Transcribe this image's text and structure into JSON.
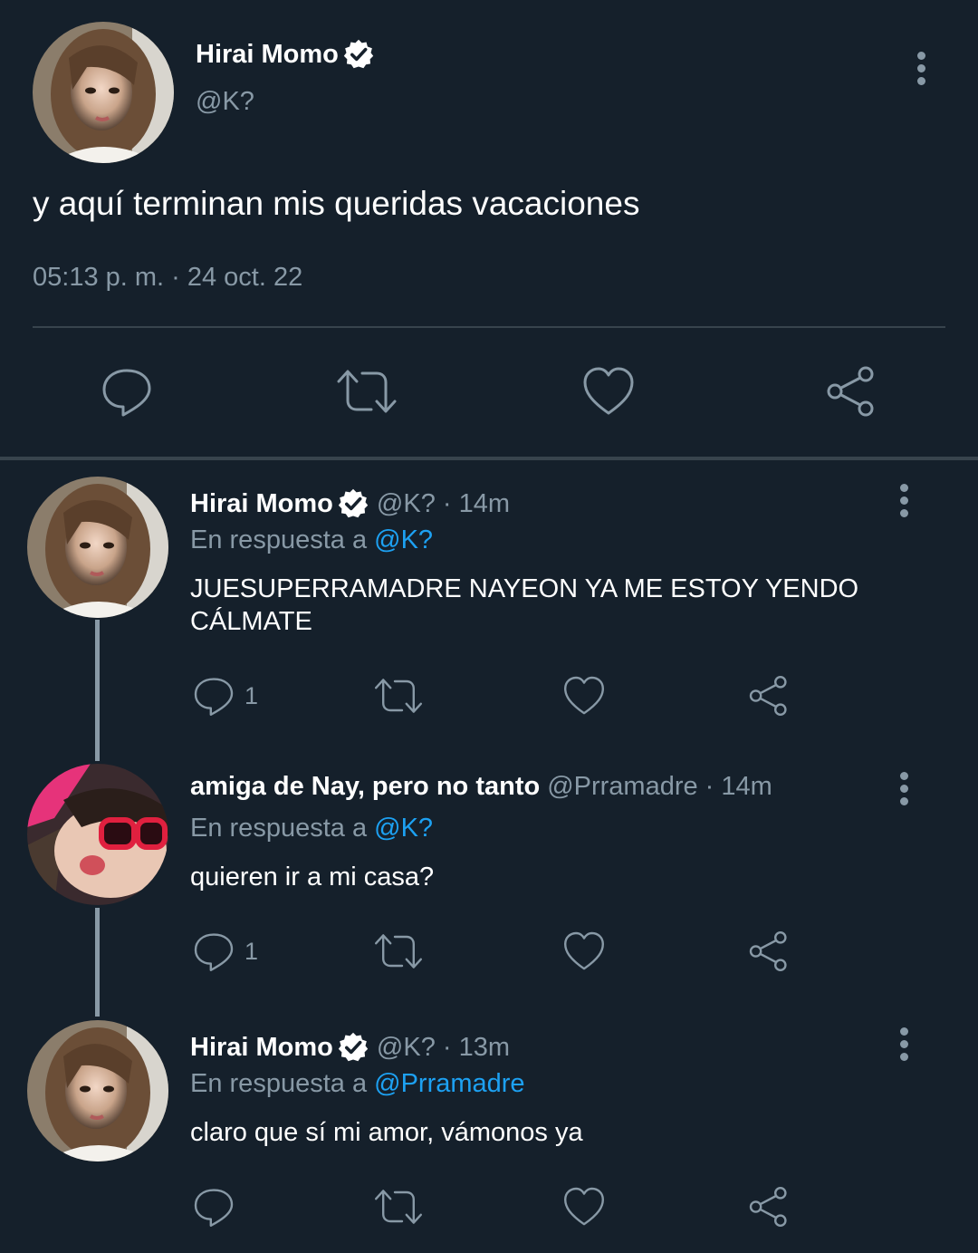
{
  "main_tweet": {
    "name": "Hirai Momo",
    "handle": "@K?",
    "text": "y aquí terminan mis queridas vacaciones",
    "timestamp": "05:13 p. m. · 24 oct. 22",
    "actions": [
      "reply-icon",
      "retweet-icon",
      "like-icon",
      "share-icon"
    ]
  },
  "replies": [
    {
      "name": "Hirai Momo",
      "verified": true,
      "handle_time": "@K? · 14m",
      "reply_prefix": "En respuesta a",
      "reply_to": "@K?",
      "text_line1": "JUESUPERRAMADRE NAYEON YA ME ESTOY YENDO",
      "text_line2": "CÁLMATE",
      "reply_count": "1"
    },
    {
      "name": "amiga de Nay, pero no tanto",
      "verified": false,
      "handle_time": "@Prramadre · 14m",
      "reply_prefix": "En respuesta a",
      "reply_to": "@K?",
      "text_line1": "quieren ir a mi casa?",
      "reply_count": "1"
    },
    {
      "name": "Hirai Momo",
      "verified": true,
      "handle_time": "@K? · 13m",
      "reply_prefix": "En respuesta a",
      "reply_to": "@Prramadre",
      "text_line1": "claro que sí mi amor, vámonos ya",
      "reply_count": ""
    }
  ],
  "colors": {
    "background": "#15202b",
    "secondary_text": "#8899a6",
    "link": "#1da1f2",
    "divider": "#38444d"
  }
}
